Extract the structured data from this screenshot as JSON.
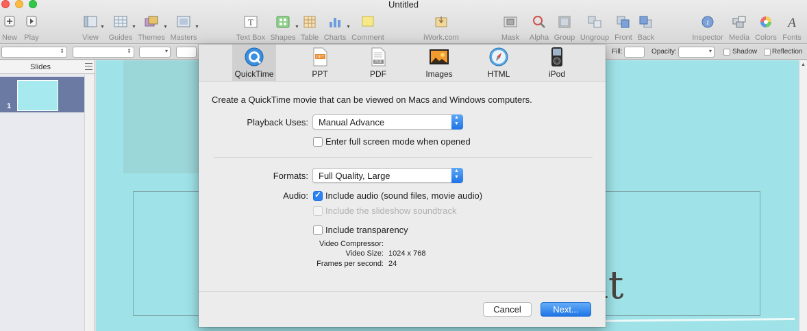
{
  "window": {
    "title": "Untitled"
  },
  "toolbar": {
    "items": [
      {
        "label": "New",
        "icon": "new-icon"
      },
      {
        "label": "Play",
        "icon": "play-icon"
      },
      {
        "label": "View",
        "icon": "view-icon"
      },
      {
        "label": "Guides",
        "icon": "guides-icon"
      },
      {
        "label": "Themes",
        "icon": "themes-icon"
      },
      {
        "label": "Masters",
        "icon": "masters-icon"
      },
      {
        "label": "Text Box",
        "icon": "text-box-icon"
      },
      {
        "label": "Shapes",
        "icon": "shapes-icon"
      },
      {
        "label": "Table",
        "icon": "table-icon"
      },
      {
        "label": "Charts",
        "icon": "charts-icon"
      },
      {
        "label": "Comment",
        "icon": "comment-icon"
      },
      {
        "label": "iWork.com",
        "icon": "iwork-icon"
      },
      {
        "label": "Mask",
        "icon": "mask-icon"
      },
      {
        "label": "Alpha",
        "icon": "alpha-icon"
      },
      {
        "label": "Group",
        "icon": "group-icon"
      },
      {
        "label": "Ungroup",
        "icon": "ungroup-icon"
      },
      {
        "label": "Front",
        "icon": "front-icon"
      },
      {
        "label": "Back",
        "icon": "back-icon"
      },
      {
        "label": "Inspector",
        "icon": "inspector-icon"
      },
      {
        "label": "Media",
        "icon": "media-icon"
      },
      {
        "label": "Colors",
        "icon": "colors-icon"
      },
      {
        "label": "Fonts",
        "icon": "fonts-icon"
      }
    ]
  },
  "formatbar": {
    "fill_label": "Fill:",
    "opacity_label": "Opacity:",
    "shadow_label": "Shadow",
    "reflection_label": "Reflection"
  },
  "sidebar": {
    "title": "Slides",
    "slides": [
      {
        "number": "1"
      }
    ]
  },
  "slide": {
    "visible_text": "it"
  },
  "export": {
    "tabs": [
      {
        "label": "QuickTime",
        "icon": "quicktime-icon",
        "active": true
      },
      {
        "label": "PPT",
        "icon": "ppt-icon",
        "active": false
      },
      {
        "label": "PDF",
        "icon": "pdf-icon",
        "active": false
      },
      {
        "label": "Images",
        "icon": "images-icon",
        "active": false
      },
      {
        "label": "HTML",
        "icon": "html-icon",
        "active": false
      },
      {
        "label": "iPod",
        "icon": "ipod-icon",
        "active": false
      }
    ],
    "description": "Create a QuickTime movie that can be viewed on Macs and Windows computers.",
    "playback": {
      "label": "Playback Uses:",
      "value": "Manual Advance"
    },
    "fullscreen": {
      "label": "Enter full screen mode when opened",
      "checked": false
    },
    "formats": {
      "label": "Formats:",
      "value": "Full Quality, Large"
    },
    "audio": {
      "label": "Audio:",
      "include_audio": {
        "label": "Include audio (sound files, movie audio)",
        "checked": true
      },
      "include_soundtrack": {
        "label": "Include the slideshow soundtrack",
        "checked": false,
        "disabled": true
      }
    },
    "transparency": {
      "label": "Include transparency",
      "checked": false
    },
    "info": {
      "video_compressor_label": "Video Compressor:",
      "video_compressor_value": "",
      "video_size_label": "Video Size:",
      "video_size_value": "1024 x 768",
      "fps_label": "Frames per second:",
      "fps_value": "24"
    },
    "buttons": {
      "cancel": "Cancel",
      "next": "Next..."
    }
  },
  "colors": {
    "accent": "#2b82f5",
    "slide_background": "#9fe3e8",
    "selected_slide_row": "#6b7aa3"
  }
}
